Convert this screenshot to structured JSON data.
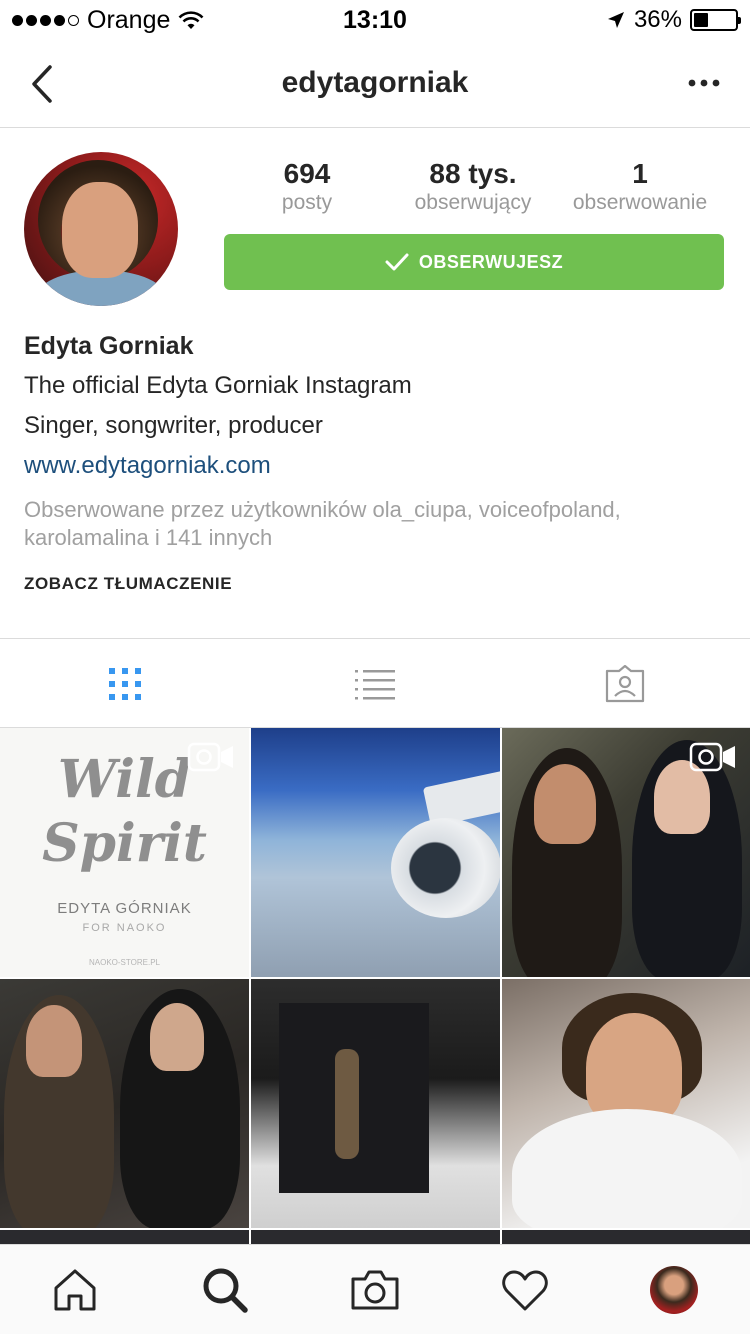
{
  "status_bar": {
    "carrier": "Orange",
    "time": "13:10",
    "battery": "36%",
    "battery_level": 0.36
  },
  "nav": {
    "title": "edytagorniak"
  },
  "profile": {
    "stats": [
      {
        "value": "694",
        "label": "posty"
      },
      {
        "value": "88 tys.",
        "label": "obserwujący"
      },
      {
        "value": "1",
        "label": "obserwowanie"
      }
    ],
    "follow_button": "OBSERWUJESZ",
    "name": "Edyta Gorniak",
    "bio_lines": [
      "The official Edyta Gorniak Instagram",
      "Singer, songwriter, producer"
    ],
    "website": "www.edytagorniak.com",
    "followed_by": "Obserwowane przez użytkowników ola_ciupa, voiceofpoland, karolamalina i 141 innych",
    "see_translation": "ZOBACZ TŁUMACZENIE"
  },
  "colors": {
    "follow_green": "#70c050",
    "link_blue": "#1d4f7c",
    "active_tab_blue": "#3897f0"
  },
  "grid": {
    "post1": {
      "title_line1": "Wild",
      "title_line2": "Spirit",
      "brand": "EDYTA GÓRNIAK",
      "brand_sub": "FOR NAOKO",
      "store": "NAOKO-STORE.PL"
    }
  },
  "icons": {
    "back": "chevron-left-icon",
    "more": "ellipsis-icon",
    "grid_tab": "grid-icon",
    "list_tab": "list-icon",
    "tagged_tab": "tagged-person-icon",
    "video": "video-camera-icon",
    "home": "home-icon",
    "search": "search-icon",
    "camera": "camera-icon",
    "heart": "heart-icon"
  }
}
